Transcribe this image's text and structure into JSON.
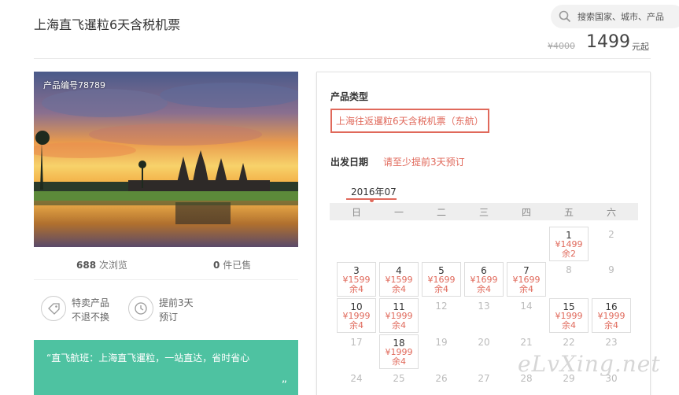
{
  "header": {
    "title": "上海直飞暹粒6天含税机票",
    "search_placeholder": "搜索国家、城市、产品",
    "price_old": "¥4000",
    "price_now": "1499",
    "price_unit": "元起"
  },
  "photo": {
    "code_label": "产品编号78789"
  },
  "stats": {
    "views_num": "688",
    "views_label": "次浏览",
    "sold_num": "0",
    "sold_label": "件已售"
  },
  "features": [
    {
      "icon": "tag-icon",
      "line1": "特卖产品",
      "line2": "不退不换"
    },
    {
      "icon": "clock-icon",
      "line1": "提前3天",
      "line2": "预订"
    }
  ],
  "promo": {
    "open_quote": "“",
    "text": "直飞航班：上海直飞暹粒，一站直达，省时省心",
    "close_quote": "”"
  },
  "booking": {
    "type_label": "产品类型",
    "type_option": "上海往返暹粒6天含税机票（东航）",
    "date_label": "出发日期",
    "date_hint": "请至少提前3天预订",
    "month": "2016年07",
    "weekdays": [
      "日",
      "一",
      "二",
      "三",
      "四",
      "五",
      "六"
    ],
    "days": [
      {
        "day": "1",
        "price": "¥1499",
        "remain": "余2"
      },
      {
        "day": "2"
      },
      {
        "day": "3",
        "price": "¥1599",
        "remain": "余4"
      },
      {
        "day": "4",
        "price": "¥1599",
        "remain": "余4"
      },
      {
        "day": "5",
        "price": "¥1699",
        "remain": "余4"
      },
      {
        "day": "6",
        "price": "¥1699",
        "remain": "余4"
      },
      {
        "day": "7",
        "price": "¥1699",
        "remain": "余4"
      },
      {
        "day": "8"
      },
      {
        "day": "9"
      },
      {
        "day": "10",
        "price": "¥1999",
        "remain": "余4"
      },
      {
        "day": "11",
        "price": "¥1999",
        "remain": "余4"
      },
      {
        "day": "12"
      },
      {
        "day": "13"
      },
      {
        "day": "14"
      },
      {
        "day": "15",
        "price": "¥1999",
        "remain": "余4"
      },
      {
        "day": "16",
        "price": "¥1999",
        "remain": "余4"
      },
      {
        "day": "17"
      },
      {
        "day": "18",
        "price": "¥1999",
        "remain": "余4"
      },
      {
        "day": "19"
      },
      {
        "day": "20"
      },
      {
        "day": "21"
      },
      {
        "day": "22"
      },
      {
        "day": "23"
      },
      {
        "day": "24"
      },
      {
        "day": "25"
      },
      {
        "day": "26"
      },
      {
        "day": "27"
      },
      {
        "day": "28"
      },
      {
        "day": "29"
      },
      {
        "day": "30"
      }
    ]
  },
  "watermark": "eLvXing.net"
}
